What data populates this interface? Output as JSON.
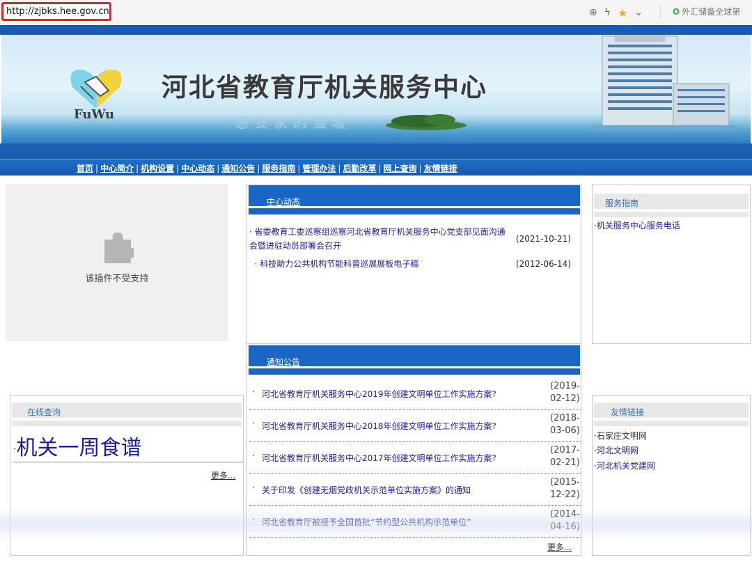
{
  "browser": {
    "url": "http://zjbks.hee.gov.cn",
    "suggestion": "外汇储备全球第"
  },
  "banner": {
    "title": "河北省教育厅机关服务中心",
    "slogan": "感受家的温暖",
    "logo_text": "FuWu"
  },
  "nav": {
    "items": [
      "首页",
      "中心简介",
      "机构设置",
      "中心动态",
      "通知公告",
      "服务指南",
      "管理办法",
      "后勤改革",
      "网上查询",
      "友情链接"
    ]
  },
  "plugin": {
    "message": "该插件不受支持"
  },
  "center_news": {
    "title": "中心动态",
    "items": [
      {
        "text": "省委教育工委巡察组巡察河北省教育厅机关服务中心党支部见面沟通会暨进驻动员部署会召开",
        "date": "(2021-10-21)"
      },
      {
        "text": "科技助力公共机构节能科普巡展展板电子稿",
        "date": "(2012-06-14)"
      }
    ]
  },
  "notices": {
    "title": "通知公告",
    "items": [
      {
        "text": "河北省教育厅机关服务中心2019年创建文明单位工作实施方案?",
        "date": "(2019-02-12)"
      },
      {
        "text": "河北省教育厅机关服务中心2018年创建文明单位工作实施方案?",
        "date": "(2018-03-06)"
      },
      {
        "text": "河北省教育厅机关服务中心2017年创建文明单位工作实施方案?",
        "date": "(2017-02-21)"
      },
      {
        "text": "关于印发《创建无烟党政机关示范单位实施方案》的通知",
        "date": "(2015-12-22)"
      },
      {
        "text": "河北省教育厅被授予全国首批“节约型公共机构示范单位”",
        "date": "(2014-04-16)"
      }
    ],
    "more": "更多..."
  },
  "guide": {
    "title": "服务指南",
    "items": [
      "机关服务中心服务电话"
    ]
  },
  "links": {
    "title": "友情链接",
    "items": [
      "石家庄文明网",
      "河北文明网",
      "河北机关党建网"
    ]
  },
  "query": {
    "title": "在线查询",
    "link": "机关一周食谱",
    "more": "更多..."
  },
  "colors": {
    "header_blue": "#1a66c4",
    "link": "#1a1aa6",
    "highlight_red": "#e5241b"
  }
}
